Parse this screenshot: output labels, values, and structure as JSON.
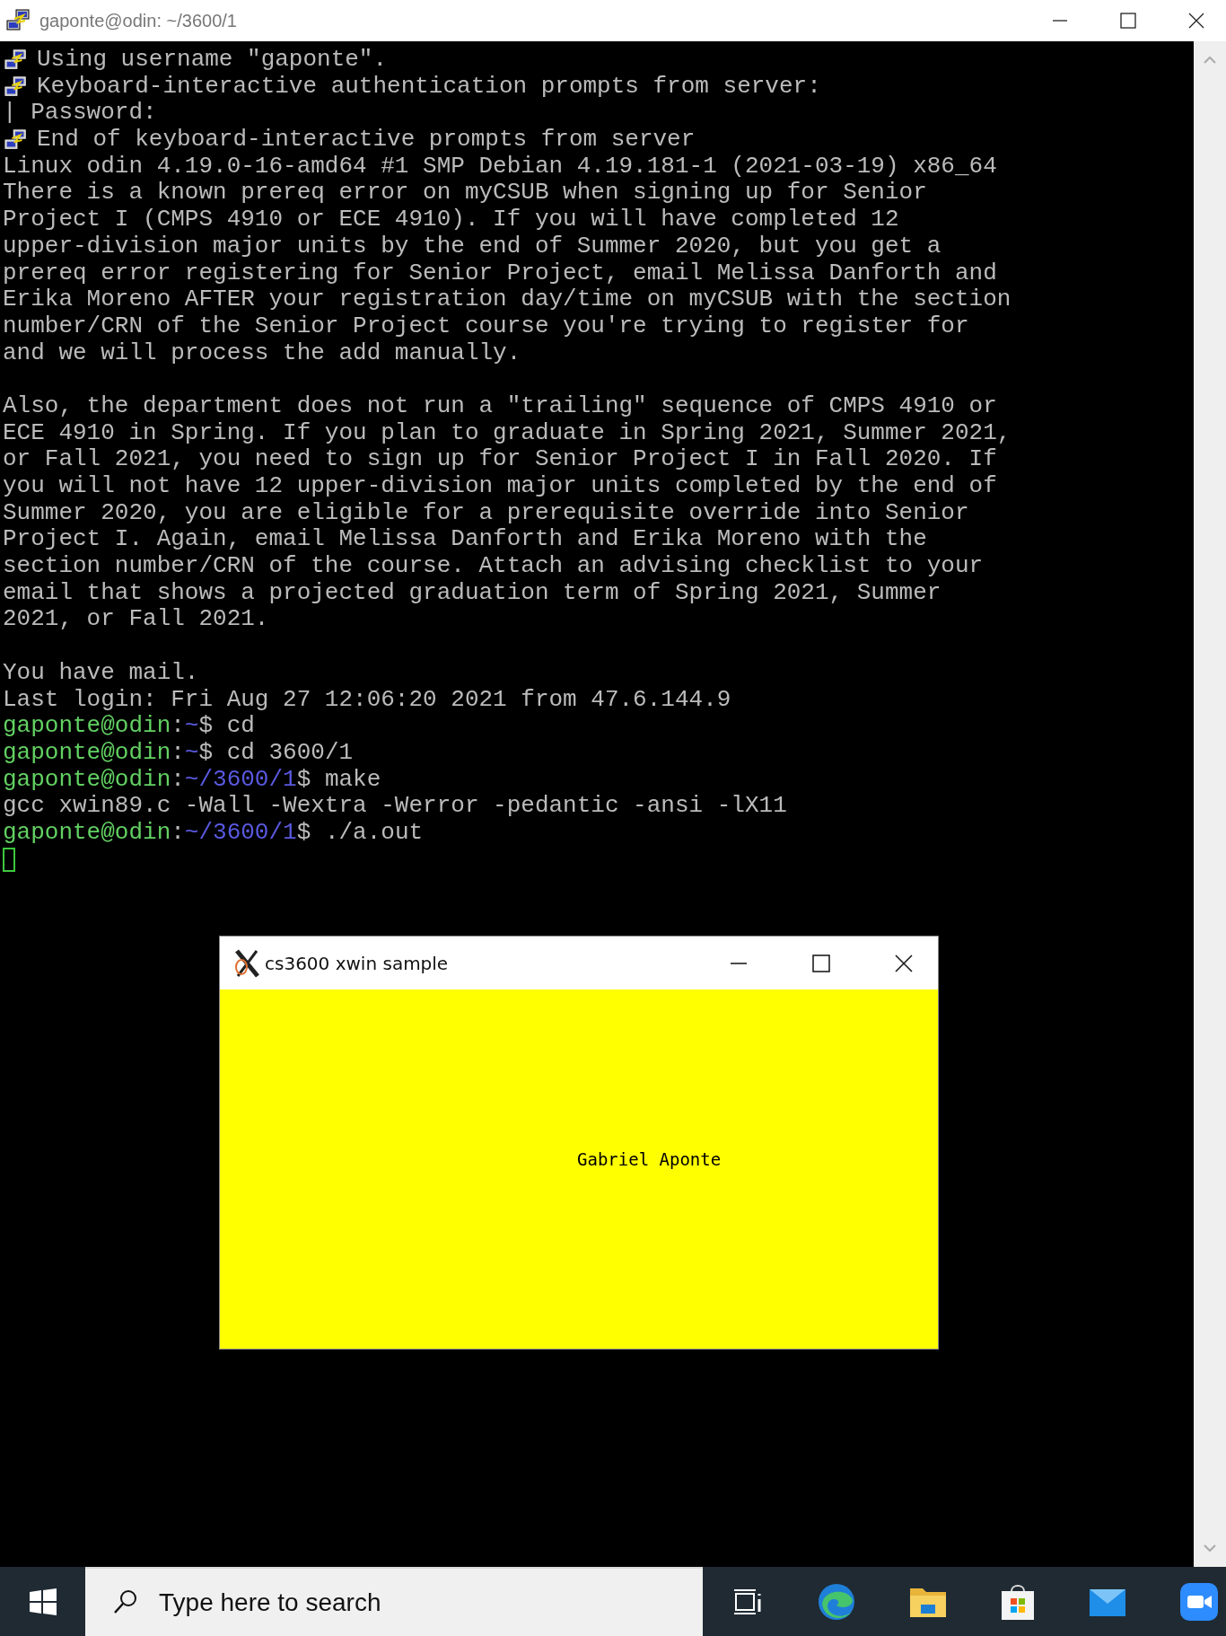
{
  "window": {
    "title": "gaponte@odin: ~/3600/1"
  },
  "terminal": {
    "lines": [
      {
        "kind": "putty",
        "text": "Using username \"gaponte\"."
      },
      {
        "kind": "putty",
        "text": "Keyboard-interactive authentication prompts from server:"
      },
      {
        "kind": "plain",
        "text": "| Password:"
      },
      {
        "kind": "putty",
        "text": "End of keyboard-interactive prompts from server"
      },
      {
        "kind": "plain",
        "text": "Linux odin 4.19.0-16-amd64 #1 SMP Debian 4.19.181-1 (2021-03-19) x86_64"
      },
      {
        "kind": "plain",
        "text": "There is a known prereq error on myCSUB when signing up for Senior"
      },
      {
        "kind": "plain",
        "text": "Project I (CMPS 4910 or ECE 4910). If you will have completed 12"
      },
      {
        "kind": "plain",
        "text": "upper-division major units by the end of Summer 2020, but you get a"
      },
      {
        "kind": "plain",
        "text": "prereq error registering for Senior Project, email Melissa Danforth and"
      },
      {
        "kind": "plain",
        "text": "Erika Moreno AFTER your registration day/time on myCSUB with the section"
      },
      {
        "kind": "plain",
        "text": "number/CRN of the Senior Project course you're trying to register for"
      },
      {
        "kind": "plain",
        "text": "and we will process the add manually."
      },
      {
        "kind": "blank"
      },
      {
        "kind": "plain",
        "text": "Also, the department does not run a \"trailing\" sequence of CMPS 4910 or"
      },
      {
        "kind": "plain",
        "text": "ECE 4910 in Spring. If you plan to graduate in Spring 2021, Summer 2021,"
      },
      {
        "kind": "plain",
        "text": "or Fall 2021, you need to sign up for Senior Project I in Fall 2020. If"
      },
      {
        "kind": "plain",
        "text": "you will not have 12 upper-division major units completed by the end of"
      },
      {
        "kind": "plain",
        "text": "Summer 2020, you are eligible for a prerequisite override into Senior"
      },
      {
        "kind": "plain",
        "text": "Project I. Again, email Melissa Danforth and Erika Moreno with the"
      },
      {
        "kind": "plain",
        "text": "section number/CRN of the course. Attach an advising checklist to your"
      },
      {
        "kind": "plain",
        "text": "email that shows a projected graduation term of Spring 2021, Summer"
      },
      {
        "kind": "plain",
        "text": "2021, or Fall 2021."
      },
      {
        "kind": "blank"
      },
      {
        "kind": "plain",
        "text": "You have mail."
      },
      {
        "kind": "plain",
        "text": "Last login: Fri Aug 27 12:06:20 2021 from 47.6.144.9"
      },
      {
        "kind": "prompt",
        "user": "gaponte@odin",
        "sep": ":",
        "path": "~",
        "symbol": "$",
        "command": "cd"
      },
      {
        "kind": "prompt",
        "user": "gaponte@odin",
        "sep": ":",
        "path": "~",
        "symbol": "$",
        "command": "cd 3600/1"
      },
      {
        "kind": "prompt",
        "user": "gaponte@odin",
        "sep": ":",
        "path": "~/3600/1",
        "symbol": "$",
        "command": "make"
      },
      {
        "kind": "plain",
        "text": "gcc xwin89.c -Wall -Wextra -Werror -pedantic -ansi -lX11"
      },
      {
        "kind": "prompt",
        "user": "gaponte@odin",
        "sep": ":",
        "path": "~/3600/1",
        "symbol": "$",
        "command": "./a.out"
      },
      {
        "kind": "cursor"
      }
    ]
  },
  "xwindow": {
    "title": "cs3600 xwin sample",
    "content": "Gabriel Aponte"
  },
  "taskbar": {
    "search": {
      "placeholder": "Type here to search"
    }
  }
}
